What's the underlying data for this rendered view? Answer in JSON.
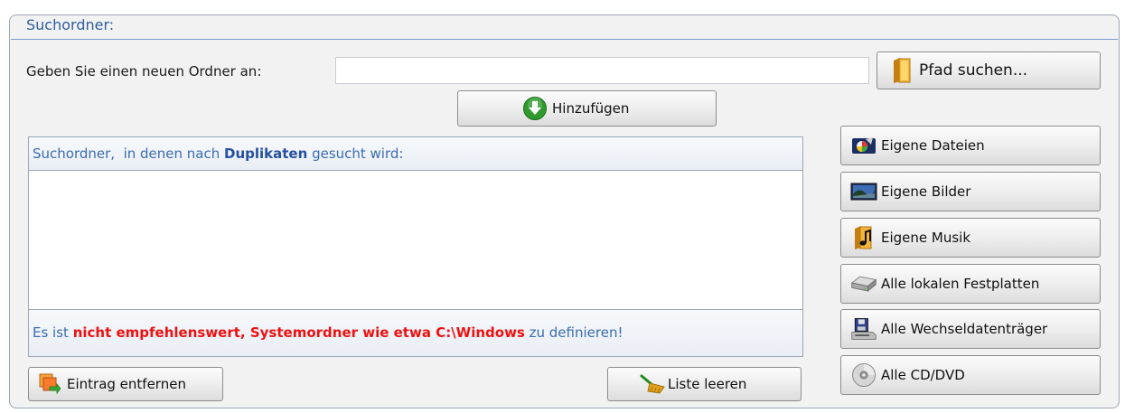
{
  "group": {
    "title": "Suchordner:"
  },
  "folder_input": {
    "label": "Geben Sie einen neuen Ordner an:",
    "value": ""
  },
  "buttons": {
    "browse": "Pfad suchen...",
    "add": "Hinzufügen",
    "remove": "Eintrag entfernen",
    "clear": "Liste leeren"
  },
  "folder_list": {
    "header_prefix": "Suchordner,  in denen nach ",
    "header_bold": "Duplikaten",
    "header_suffix": " gesucht wird:",
    "items": [],
    "warning_prefix": "Es ist ",
    "warning_bold": "nicht empfehlenswert, Systemordner wie etwa C:\\Windows",
    "warning_suffix": " zu definieren!"
  },
  "quick_locations": [
    {
      "label": "Eigene Dateien",
      "icon": "documents-icon"
    },
    {
      "label": "Eigene Bilder",
      "icon": "pictures-icon"
    },
    {
      "label": "Eigene Musik",
      "icon": "music-icon"
    },
    {
      "label": "Alle lokalen Festplatten",
      "icon": "hard-drive-icon"
    },
    {
      "label": "Alle Wechseldatenträger",
      "icon": "removable-drive-icon"
    },
    {
      "label": "Alle CD/DVD",
      "icon": "cd-dvd-icon"
    }
  ],
  "colors": {
    "accent_blue": "#2e5e9e",
    "warning_red": "#ee1111",
    "add_green": "#2f9a2f",
    "folder_orange": "#e2a020"
  }
}
